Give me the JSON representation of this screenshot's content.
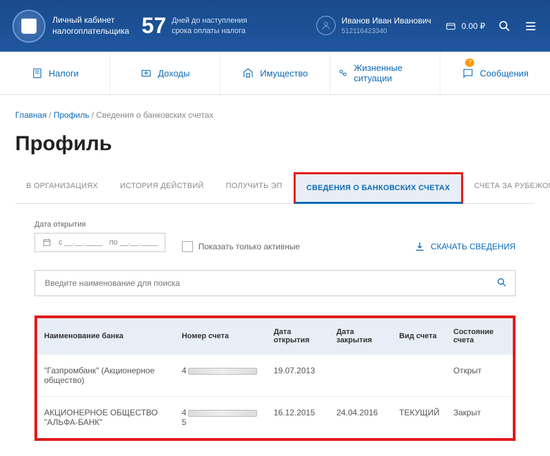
{
  "header": {
    "logo_line1": "Личный кабинет",
    "logo_line2": "налогоплательщика",
    "days": "57",
    "days_line1": "Дней до наступления",
    "days_line2": "срока оплаты налога",
    "user_name": "Иванов Иван Иванович",
    "user_id": "512116423340",
    "balance": "0.00 ₽"
  },
  "nav": {
    "taxes": "Налоги",
    "income": "Доходы",
    "property": "Имущество",
    "situations": "Жизненные ситуации",
    "messages": "Сообщения",
    "messages_badge": "7"
  },
  "breadcrumb": {
    "home": "Главная",
    "profile": "Профиль",
    "current": "Сведения о банковских счетах"
  },
  "page_title": "Профиль",
  "tabs": {
    "t0": "В ОРГАНИЗАЦИЯХ",
    "t1": "ИСТОРИЯ ДЕЙСТВИЙ",
    "t2": "ПОЛУЧИТЬ ЭП",
    "t3": "СВЕДЕНИЯ О БАНКОВСКИХ СЧЕТАХ",
    "t4": "СЧЕТА ЗА РУБЕЖОМ"
  },
  "filters": {
    "date_label": "Дата открытия",
    "date_from": "с __.__.____",
    "date_to": "по __.__.____",
    "active_only": "Показать только активные",
    "download": "СКАЧАТЬ СВЕДЕНИЯ",
    "search_placeholder": "Введите наименование для поиска"
  },
  "table": {
    "headers": {
      "bank": "Наименование банка",
      "account": "Номер счета",
      "open": "Дата открытия",
      "close": "Дата закрытия",
      "type": "Вид счета",
      "status": "Состояние счета"
    },
    "rows": [
      {
        "bank": "\"Газпромбанк\" (Акционерное общество)",
        "acc_prefix": "4",
        "acc_suffix": "",
        "open": "19.07.2013",
        "close": "",
        "type": "",
        "status": "Открыт"
      },
      {
        "bank": "АКЦИОНЕРНОЕ ОБЩЕСТВО \"АЛЬФА-БАНК\"",
        "acc_prefix": "4",
        "acc_suffix": "5",
        "open": "16.12.2015",
        "close": "24.04.2016",
        "type": "ТЕКУЩИЙ",
        "status": "Закрыт"
      }
    ]
  }
}
